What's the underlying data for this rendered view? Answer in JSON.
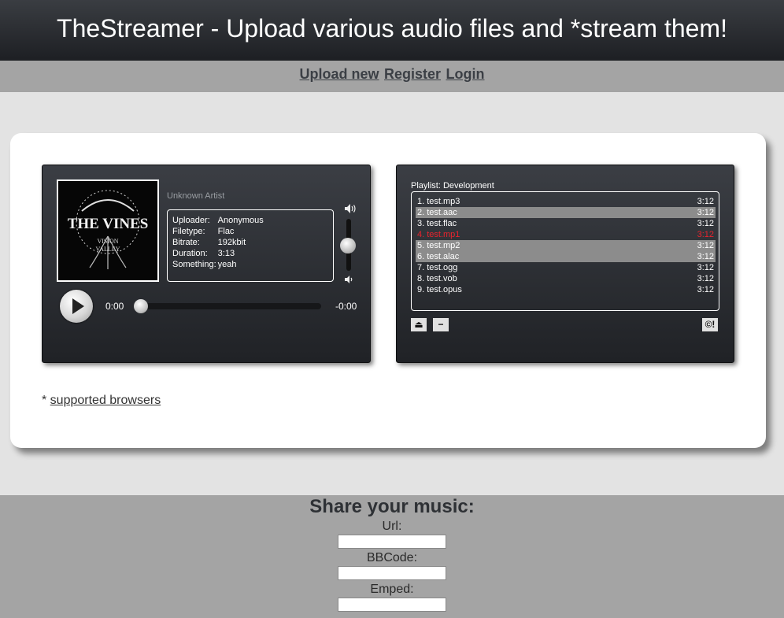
{
  "header": {
    "title": "TheStreamer - Upload various audio files and *stream them!"
  },
  "nav": {
    "upload": "Upload new",
    "register": "Register",
    "login": "Login"
  },
  "player": {
    "cover_lines": [
      "THE VINES",
      "VISION",
      "VALLEY"
    ],
    "artist": "Unknown Artist",
    "meta": [
      {
        "key": "Uploader:",
        "value": "Anonymous"
      },
      {
        "key": "Filetype:",
        "value": "Flac"
      },
      {
        "key": "Bitrate:",
        "value": "192kbit"
      },
      {
        "key": "Duration:",
        "value": "3:13"
      },
      {
        "key": "Something:",
        "value": "yeah"
      }
    ],
    "time_current": "0:00",
    "time_remaining": "-0:00",
    "seek_fraction": 0,
    "volume_fraction": 0.5,
    "icons": {
      "play": "play-icon",
      "volume_high": "volume-high-icon",
      "volume_low": "volume-low-icon"
    }
  },
  "playlist": {
    "title": "Playlist: Development",
    "tracks": [
      {
        "label": "1. test.mp3",
        "duration": "3:12",
        "selected": false,
        "current": false
      },
      {
        "label": "2. test.aac",
        "duration": "3:12",
        "selected": true,
        "current": false
      },
      {
        "label": "3. test.flac",
        "duration": "3:12",
        "selected": false,
        "current": false
      },
      {
        "label": "4. test.mp1",
        "duration": "3:12",
        "selected": false,
        "current": true
      },
      {
        "label": "5. test.mp2",
        "duration": "3:12",
        "selected": true,
        "current": false
      },
      {
        "label": "6. test.alac",
        "duration": "3:12",
        "selected": true,
        "current": false
      },
      {
        "label": "7. test.ogg",
        "duration": "3:12",
        "selected": false,
        "current": false
      },
      {
        "label": "8. test.vob",
        "duration": "3:12",
        "selected": false,
        "current": false
      },
      {
        "label": "9. test.opus",
        "duration": "3:12",
        "selected": false,
        "current": false
      }
    ],
    "buttons": {
      "eject": "⏏",
      "remove": "−",
      "copyright": "©!"
    }
  },
  "footnote": {
    "prefix": "* ",
    "link": "supported browsers"
  },
  "share": {
    "title": "Share your music:",
    "url_label": "Url:",
    "bbcode_label": "BBCode:",
    "embed_label": "Emped:",
    "url_value": "",
    "bbcode_value": "",
    "embed_value": ""
  },
  "colors": {
    "accent_red": "#e8232d",
    "nav_bg": "#a4a4a4",
    "panel_dark": "#202226"
  }
}
